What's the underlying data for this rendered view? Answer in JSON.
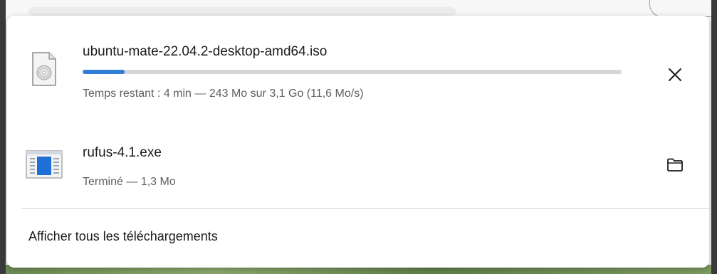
{
  "downloads": [
    {
      "icon": "disc-image-file-icon",
      "filename": "ubuntu-mate-22.04.2-desktop-amd64.iso",
      "status": "Temps restant : 4 min — 243 Mo sur 3,1 Go (11,6 Mo/s)",
      "progress_fraction": 0.078,
      "action_icon": "close-icon"
    },
    {
      "icon": "executable-file-icon",
      "filename": "rufus-4.1.exe",
      "status": "Terminé — 1,3 Mo",
      "action_icon": "folder-icon"
    }
  ],
  "footer": {
    "show_all_label": "Afficher tous les téléchargements"
  },
  "colors": {
    "progress_fill": "#2f7ed8",
    "progress_track": "#d6d6d6"
  }
}
